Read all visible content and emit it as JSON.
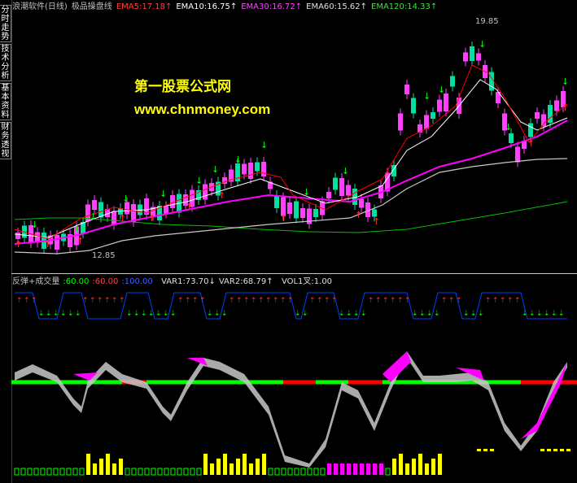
{
  "sidebar": {
    "tabs": [
      {
        "label": "分时走势"
      },
      {
        "label": "技术分析"
      },
      {
        "label": "基本资料"
      },
      {
        "label": "财务透视"
      }
    ]
  },
  "header": {
    "title": "浪潮软件(日线)",
    "indicator_name": "极品操盘线",
    "ema5": "EMA5:17.18↑",
    "ema10": "EMA10:16.75↑",
    "ema30": "EMA30:16.72↑",
    "ema60": "EMA60:15.62↑",
    "ema120": "EMA120:14.33↑"
  },
  "chart": {
    "high_label": "19.85",
    "low_label": "12.85"
  },
  "watermark": {
    "line1": "第一股票公式网",
    "line2": "www.chnmoney.com"
  },
  "panel2": {
    "name": "反弹+成交量",
    "level_a": ":60.00",
    "level_b": ":60.00",
    "level_c": ":100.00",
    "var1": "VAR1:73.70↓",
    "var2": "VAR2:68.79↑",
    "vol1": "VOL1叉:1.00"
  },
  "colors": {
    "ema5": "#ff0000",
    "ema10": "#ffffff",
    "ema30": "#ff00ff",
    "ema60": "#c8c8c8",
    "ema120": "#00c000",
    "up_candle": "#ff40ff",
    "down_candle": "#00e0a0",
    "signal_up": "#ff3030",
    "signal_down": "#00ff00",
    "osc_line": "#0040ff",
    "zero_up": "#ff0000",
    "zero_down": "#00ff00",
    "vol_yellow": "#ffff00",
    "vol_magenta": "#ff00ff"
  }
}
